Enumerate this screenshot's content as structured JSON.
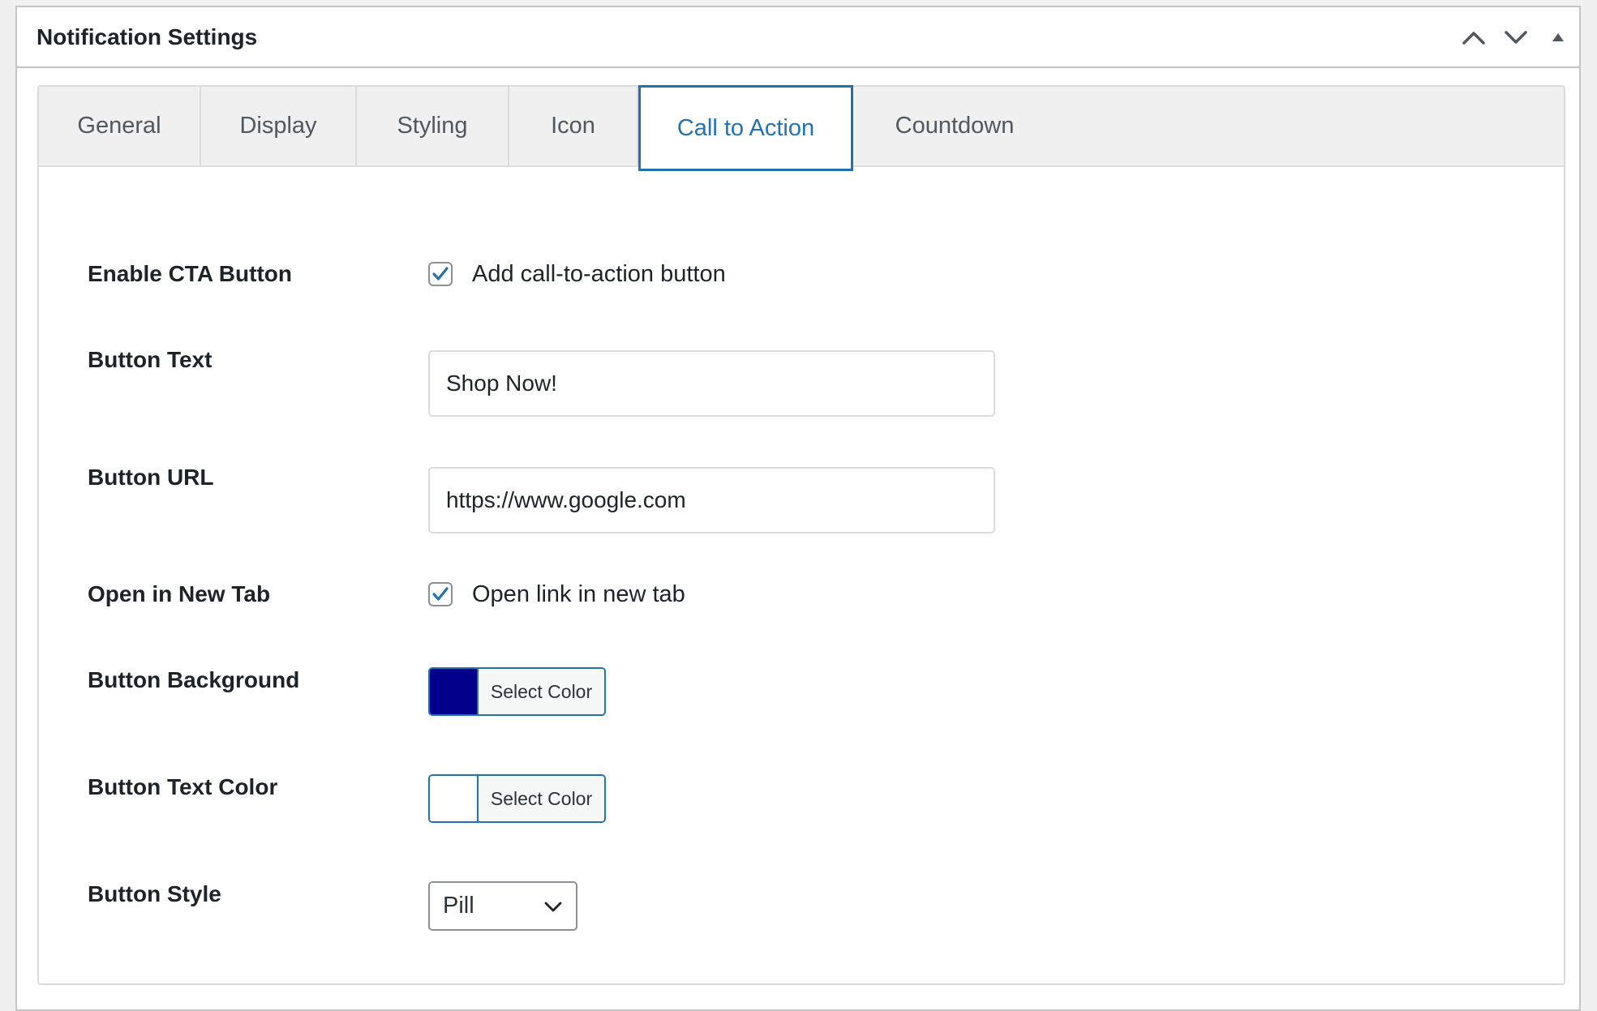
{
  "panel": {
    "title": "Notification Settings",
    "actions": [
      {
        "name": "move-up-icon"
      },
      {
        "name": "move-down-icon"
      },
      {
        "name": "toggle-panel-icon"
      }
    ]
  },
  "tabs": [
    {
      "label": "General",
      "active": false
    },
    {
      "label": "Display",
      "active": false
    },
    {
      "label": "Styling",
      "active": false
    },
    {
      "label": "Icon",
      "active": false
    },
    {
      "label": "Call to Action",
      "active": true
    },
    {
      "label": "Countdown",
      "active": false
    }
  ],
  "fields": {
    "enable_cta": {
      "label": "Enable CTA Button",
      "checkbox_label": "Add call-to-action button",
      "checked": true
    },
    "button_text": {
      "label": "Button Text",
      "value": "Shop Now!"
    },
    "button_url": {
      "label": "Button URL",
      "value": "https://www.google.com"
    },
    "open_new_tab": {
      "label": "Open in New Tab",
      "checkbox_label": "Open link in new tab",
      "checked": true
    },
    "button_background": {
      "label": "Button Background",
      "button_label": "Select Color",
      "color": "#00008b"
    },
    "button_text_color": {
      "label": "Button Text Color",
      "button_label": "Select Color",
      "color": "#ffffff"
    },
    "button_style": {
      "label": "Button Style",
      "selected": "Pill"
    }
  },
  "colors": {
    "accent": "#2271b1",
    "text": "#1d2327",
    "muted_text": "#50575e",
    "border": "#c3c4c7",
    "tab_bar_bg": "#f0f0f1"
  }
}
